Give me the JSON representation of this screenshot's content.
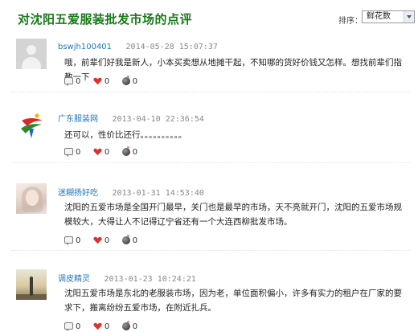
{
  "header": {
    "title": "对沈阳五爱服装批发市场的点评",
    "sort_label": "排序：",
    "sort_selected": "鲜花数"
  },
  "comments": [
    {
      "avatar": "default-avatar",
      "author": "bswjh100401",
      "date": "2014-05-28 15:07:37",
      "text": "哦，前辈们好我是新人，小本买卖想从地摊干起，不知哪的货好价钱又怎样。想找前辈们指教一下",
      "reply_count": "0",
      "flower_count": "0",
      "egg_count": "0"
    },
    {
      "avatar": "guangdong-fuzhuang-logo",
      "author": "广东服装网",
      "date": "2013-04-10 22:36:54",
      "text": "还可以，性价比还行。。。。。。。。。。",
      "reply_count": "0",
      "flower_count": "0",
      "egg_count": "0"
    },
    {
      "avatar": "user-photo",
      "author": "迷糊扬好吃",
      "date": "2013-01-31 14:53:40",
      "text": "沈阳的五爱市场是全国开门最早，关门也是最早的市场，天不亮就开门，沈阳的五爱市场规模较大，大得让人不记得辽宁省还有一个大连西柳批发市场。",
      "reply_count": "0",
      "flower_count": "0",
      "egg_count": "0"
    },
    {
      "avatar": "user-photo",
      "author": "调皮精灵",
      "date": "2013-01-23 10:24:21",
      "text": "沈阳五爱市场是东北的老服装市场，因为老，单位面积偏小，许多有实力的租户在厂家的要求下，搬离纷纷五爱市场，在附近扎兵。",
      "reply_count": "0",
      "flower_count": "0",
      "egg_count": "0"
    }
  ],
  "colors": {
    "title": "#1a7a1a",
    "author_link": "#2277bb",
    "heart": "#e03030"
  }
}
